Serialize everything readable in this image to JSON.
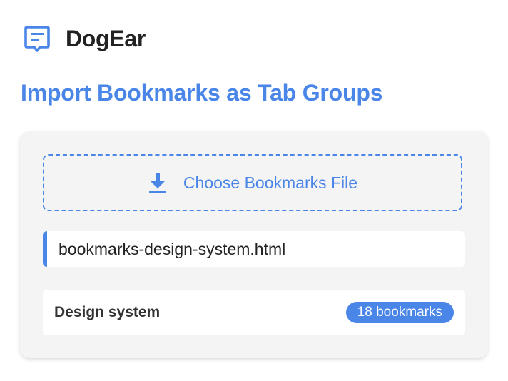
{
  "app": {
    "name": "DogEar",
    "icon": "comment-note-icon"
  },
  "page": {
    "title": "Import Bookmarks as Tab Groups"
  },
  "import": {
    "choose_label": "Choose Bookmarks File",
    "choose_icon": "download-icon",
    "file_name": "bookmarks-design-system.html"
  },
  "groups": [
    {
      "name": "Design system",
      "count_label": "18 bookmarks"
    }
  ],
  "colors": {
    "accent": "#4a86e8",
    "card_background": "#f4f4f4",
    "text_dark": "#222222"
  }
}
